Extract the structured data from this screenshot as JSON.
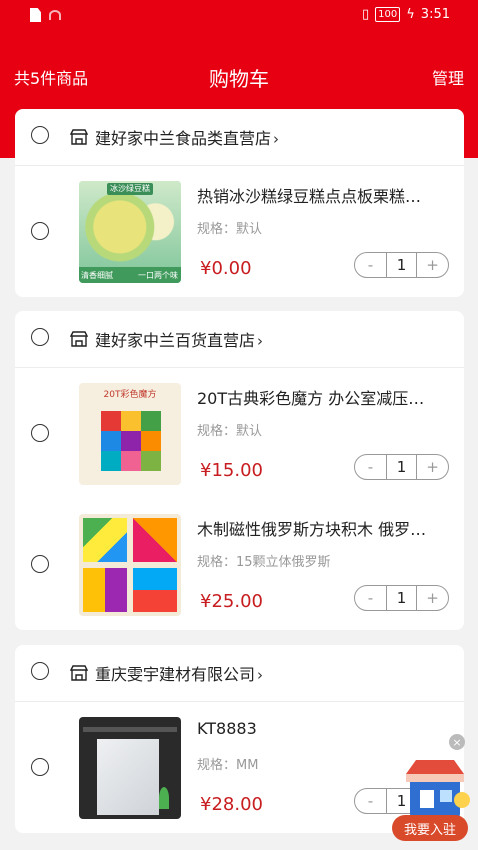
{
  "status_bar": {
    "time": "3:51",
    "battery": "100"
  },
  "header": {
    "count_label": "共5件商品",
    "title": "购物车",
    "manage_label": "管理"
  },
  "stores": [
    {
      "name": "建好家中兰食品类直营店",
      "items": [
        {
          "title": "热销冰沙糕绿豆糕点点板栗糕…",
          "spec": "规格：默认",
          "price": "¥0.00",
          "qty": "1",
          "thumb_texts": [
            "冰沙绿豆糕",
            "清香细腻",
            "一口两个味"
          ]
        }
      ]
    },
    {
      "name": "建好家中兰百货直营店",
      "items": [
        {
          "title": "20T古典彩色魔方 办公室减压…",
          "spec": "规格：默认",
          "price": "¥15.00",
          "qty": "1",
          "thumb_texts": [
            "20T彩色魔方"
          ]
        },
        {
          "title": "木制磁性俄罗斯方块积木 俄罗…",
          "spec": "规格：15颗立体俄罗斯",
          "price": "¥25.00",
          "qty": "1"
        }
      ]
    },
    {
      "name": "重庆雯宇建材有限公司",
      "items": [
        {
          "title": "KT8883",
          "spec": "规格：MM",
          "price": "¥28.00",
          "qty": "1"
        }
      ]
    }
  ],
  "stepper": {
    "minus": "-",
    "plus": "+"
  },
  "chevron": "›",
  "floating": {
    "label": "我要入驻",
    "close": "×"
  },
  "colors": {
    "brand_red": "#e60012",
    "price_red": "#c81d20"
  }
}
